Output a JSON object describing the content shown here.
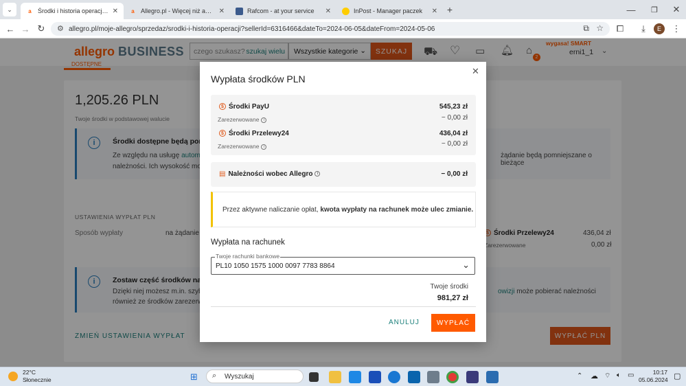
{
  "browser": {
    "tabs": [
      {
        "title": "Środki i historia operacji - Allegro",
        "icon": "allegro-icon"
      },
      {
        "title": "Allegro.pl - Więcej niż aukcje. N",
        "icon": "allegro-icon"
      },
      {
        "title": "Rafcom - at your service",
        "icon": "page-icon"
      },
      {
        "title": "InPost - Manager paczek",
        "icon": "inpost-icon"
      }
    ],
    "url": "allegro.pl/moje-allegro/sprzedaz/srodki-i-historia-operacji?sellerId=6316466&dateTo=2024-06-05&dateFrom=2024-05-06",
    "profile_initial": "E"
  },
  "header": {
    "logo": "allegro",
    "logo_business": "BUSINESS",
    "search_placeholder": "czego szukasz?",
    "search_link": "szukaj wielu",
    "category": "Wszystkie kategorie",
    "search_button": "SZUKAJ",
    "smart_badge": "wygasa! SMART",
    "cart_count": "2",
    "username": "erni1_1"
  },
  "background": {
    "tab_label": "DOSTĘPNE",
    "balance": "1,205.26 PLN",
    "balance_caption": "Twoje środki w podstawowej walucie",
    "info1_title": "Środki dostępne będą pomni",
    "info1_text_a": "Ze względu na usługę",
    "info1_link": "automat",
    "info1_text_b": "należności. Ich wysokość może",
    "info1_right": "żądanie będą pomniejszane o bieżące",
    "settings_heading": "USTAWIENIA WYPŁAT PLN",
    "method_label": "Sposób wypłaty",
    "method_value": "na żądanie",
    "p24_label": "Środki Przelewy24",
    "p24_value": "436,04 zł",
    "reserved_label": "Zarezerwowane",
    "reserved_value": "0,00 zł",
    "info2_title": "Zostaw część środków na kor",
    "info2_text_a": "Dzięki niej możesz m.in. szybci",
    "info2_text_b": "również ze środków zarezerwo",
    "info2_link": "owizji",
    "info2_right": "może pobierać należności",
    "change_link": "ZMIEŃ USTAWIENIA WYPŁAT",
    "payout_button": "WYPŁAĆ PLN"
  },
  "modal": {
    "title": "Wypłata środków PLN",
    "payu_label": "Środki PayU",
    "payu_value": "545,23 zł",
    "payu_reserved_label": "Zarezerwowane",
    "payu_reserved_value": "− 0,00 zł",
    "p24_label": "Środki Przelewy24",
    "p24_value": "436,04 zł",
    "p24_reserved_label": "Zarezerwowane",
    "p24_reserved_value": "− 0,00 zł",
    "debts_label": "Należności wobec Allegro",
    "debts_value": "− 0,00 zł",
    "warning_text": "Przez aktywne naliczanie opłat,",
    "warning_bold": "kwota wypłaty na rachunek może ulec zmianie.",
    "account_heading": "Wypłata na rachunek",
    "account_field_label": "Twoje rachunki bankowe",
    "account_value": "PL10 1050 1575 1000 0097 7783 8864",
    "your_funds_label": "Twoje środki",
    "your_funds_value": "981,27 zł",
    "cancel": "ANULUJ",
    "confirm": "WYPŁAĆ"
  },
  "taskbar": {
    "weather_temp": "22°C",
    "weather_desc": "Słonecznie",
    "search": "Wyszukaj",
    "time": "10:17",
    "date": "05.06.2024"
  },
  "colors": {
    "accent": "#ff5a00",
    "link": "#1a7f7a",
    "info": "#2a7ebd"
  }
}
